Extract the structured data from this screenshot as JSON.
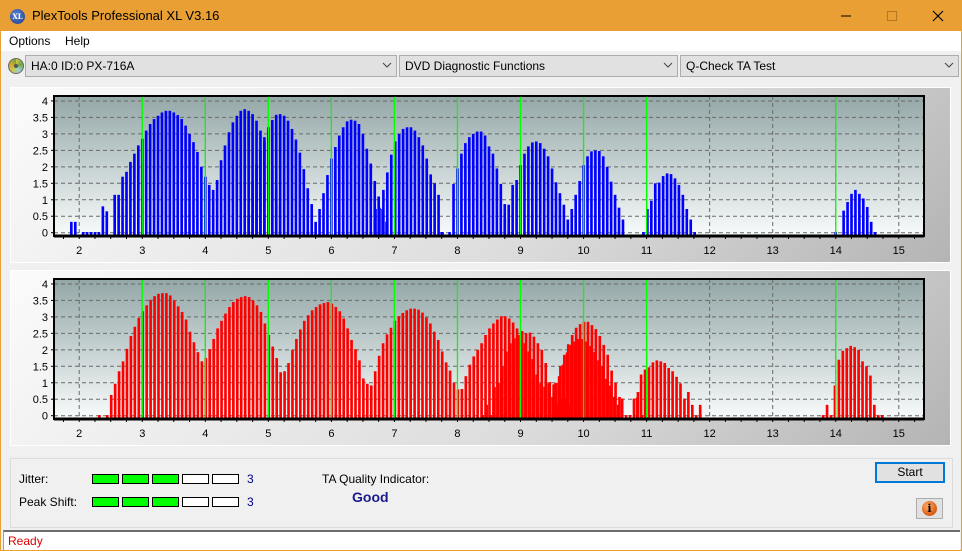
{
  "window": {
    "title": "PlexTools Professional XL V3.16",
    "icon_label": "XL",
    "controls": [
      "minimize-icon",
      "maximize-icon",
      "close-icon"
    ]
  },
  "menu": {
    "items": [
      "Options",
      "Help"
    ]
  },
  "toolbar": {
    "drive": "HA:0 ID:0  PX-716A",
    "function_group": "DVD Diagnostic Functions",
    "test": "Q-Check TA Test"
  },
  "colors": {
    "titlebar": "#e99f34",
    "land_bars": "#0000ff",
    "pit_bars": "#ff0000",
    "reference_lines": "#00ff00",
    "meter_on": "#00ff00",
    "status_text": "#e00000",
    "quality_text": "#1a1a8c"
  },
  "chart_data": [
    {
      "type": "bar",
      "name": "top-chart",
      "series_color": "#0000ff",
      "x_ticks": [
        "2",
        "3",
        "4",
        "5",
        "6",
        "7",
        "8",
        "9",
        "10",
        "11",
        "12",
        "13",
        "14",
        "15"
      ],
      "y_ticks": [
        "0",
        "0.5",
        "1",
        "1.5",
        "2",
        "2.5",
        "3",
        "3.5",
        "4"
      ],
      "xlim": [
        1.6,
        15.4
      ],
      "ylim": [
        -0.1,
        4.15
      ],
      "reference_lines_x": [
        3,
        4,
        5,
        6,
        7,
        8,
        9,
        10,
        11,
        14
      ],
      "grid": true,
      "bar_step": 0.0625,
      "clusters": [
        {
          "start": 1.875,
          "values": [
            0.33,
            0.33,
            0,
            0.02,
            0.02,
            0.02,
            0.02,
            0.02,
            0.8,
            0.65,
            0,
            1.15,
            1.15,
            1.7,
            1.85,
            2.15,
            2.4,
            2.65,
            2.85,
            3.1,
            3.3,
            3.45,
            3.55,
            3.65,
            3.7,
            3.7,
            3.65,
            3.57,
            3.45,
            3.25,
            3.0,
            2.75,
            2.45,
            2.0,
            1.7,
            1.45,
            1.3,
            1.6,
            2.2,
            2.65,
            3.05,
            3.35,
            3.55,
            3.7,
            3.75,
            3.7,
            3.6,
            3.4,
            3.1,
            2.75,
            2.2,
            1.9,
            1.35,
            0.85
          ]
        },
        {
          "start": 4.5,
          "values": [
            0.02,
            0,
            0.02,
            0.52,
            1.58,
            2.07,
            2.5,
            2.9,
            3.2,
            3.42,
            3.58,
            3.6,
            3.55,
            3.4,
            3.15,
            2.83,
            2.43,
            1.93,
            1.35,
            0.87
          ]
        },
        {
          "start": 5.75,
          "values": [
            0.33,
            0.72,
            1.2,
            1.75,
            2.25,
            2.6,
            2.95,
            3.2,
            3.38,
            3.43,
            3.4,
            3.3,
            3.0,
            2.55,
            2.1,
            1.57,
            1.1,
            0.72,
            0.33
          ]
        },
        {
          "start": 6.7,
          "values": [
            0.72,
            0.76,
            1.3,
            1.83,
            2.37,
            2.77,
            3.0,
            3.15,
            3.2,
            3.2,
            3.1,
            2.9,
            2.65,
            2.25,
            1.77,
            1.5,
            1.15,
            0.02
          ]
        },
        {
          "start": 7.75,
          "values": [
            0.02,
            0,
            0.02,
            1.48,
            1.95,
            2.4,
            2.72,
            2.9,
            3.0,
            3.07,
            3.07,
            2.95,
            2.62,
            2.4,
            1.95,
            1.48,
            0.87,
            0.02,
            0.02
          ]
        },
        {
          "start": 8.75,
          "values": [
            0.4,
            0.85,
            1.45,
            1.6,
            2.05,
            2.4,
            2.62,
            2.74,
            2.77,
            2.72,
            2.55,
            2.32,
            1.95,
            1.53,
            1.2,
            0.85
          ]
        },
        {
          "start": 9.75,
          "values": [
            0.4,
            0.72,
            1.15,
            1.57,
            2.05,
            2.32,
            2.47,
            2.5,
            2.48,
            2.32,
            2.0,
            1.55,
            1.15,
            0.76,
            0.4
          ]
        },
        {
          "start": 10.95,
          "values": [
            0.02,
            0.72,
            0.97,
            1.5,
            1.52,
            1.72,
            1.8,
            1.78,
            1.65,
            1.45,
            1.15,
            0.72,
            0.4,
            0.02
          ]
        },
        {
          "start": 14.0,
          "values": [
            0.02,
            0,
            0.67,
            0.93,
            1.18,
            1.3,
            1.18,
            1.04,
            0.78,
            0.33,
            0.02
          ]
        }
      ]
    },
    {
      "type": "bar",
      "name": "bottom-chart",
      "series_color": "#ff0000",
      "x_ticks": [
        "2",
        "3",
        "4",
        "5",
        "6",
        "7",
        "8",
        "9",
        "10",
        "11",
        "12",
        "13",
        "14",
        "15"
      ],
      "y_ticks": [
        "0",
        "0.5",
        "1",
        "1.5",
        "2",
        "2.5",
        "3",
        "3.5",
        "4"
      ],
      "xlim": [
        1.6,
        15.4
      ],
      "ylim": [
        -0.1,
        4.15
      ],
      "reference_lines_x": [
        3,
        4,
        5,
        6,
        7,
        8,
        9,
        10,
        11,
        14
      ],
      "grid": true,
      "bar_step": 0.0625,
      "clusters": [
        {
          "start": 2.32,
          "values": [
            0.02,
            0,
            0.02,
            0.63,
            0.97,
            1.35,
            1.65,
            2.03,
            2.42,
            2.7,
            2.97,
            3.17,
            3.35,
            3.52,
            3.63,
            3.7,
            3.72,
            3.72,
            3.65,
            3.5,
            3.32,
            3.15,
            2.92,
            2.55,
            2.23,
            1.93,
            1.65,
            1.75,
            2.02,
            2.33,
            2.65,
            2.88,
            3.1,
            3.3,
            3.45,
            3.55,
            3.6,
            3.63,
            3.6,
            3.5,
            3.35,
            3.15,
            2.8,
            2.45,
            2.1,
            1.75,
            1.32,
            1.35,
            1.6,
            2.0,
            2.33,
            2.62,
            2.88,
            3.05,
            3.2,
            3.3,
            3.38,
            3.42,
            3.45,
            3.4,
            3.3,
            3.17,
            2.95,
            2.65,
            2.3,
            2.02,
            1.68,
            1.13,
            0.97,
            0.92,
            1.35,
            1.82,
            2.2,
            2.47,
            2.67,
            2.88,
            3.02,
            3.12,
            3.2,
            3.25,
            3.25,
            3.22,
            3.13,
            2.98,
            2.8,
            2.55,
            2.3,
            1.95,
            1.62,
            1.37,
            1.0,
            0.8,
            0.81,
            1.2,
            1.55,
            1.8,
            2.0,
            2.2,
            2.45,
            2.65,
            2.8,
            2.92,
            3.02,
            3.02,
            2.95,
            2.83,
            2.65,
            2.45,
            2.2,
            1.95,
            1.72,
            1.25,
            0.98,
            0.88,
            0.98,
            0.57,
            1.0,
            1.5,
            1.85,
            2.17,
            2.45,
            2.67,
            2.78,
            2.85,
            2.85,
            2.75,
            2.63,
            2.42,
            2.15,
            1.85,
            1.37,
            1.0,
            0.57
          ]
        },
        {
          "start": 8.4,
          "values": [
            0.02,
            0.33,
            0.02,
            0.87,
            1.0,
            1.5,
            1.95,
            2.2,
            2.35,
            2.45,
            2.57,
            2.5,
            2.52,
            2.4,
            2.2,
            2.0,
            1.6,
            1.02,
            0.95,
            0.33,
            0.52,
            0.52,
            0.33
          ]
        },
        {
          "start": 9.55,
          "values": [
            0.98,
            1.2,
            1.55,
            1.92,
            2.15,
            2.25,
            2.33,
            2.33,
            2.25,
            2.12,
            1.93,
            1.68,
            1.5,
            1.12,
            0.92,
            0.57,
            0.33,
            0.52,
            0.02,
            0.02,
            0.52,
            0.72,
            0.02
          ]
        },
        {
          "start": 10.85,
          "values": [
            0.55,
            1.25,
            1.4,
            1.47,
            1.62,
            1.68,
            1.65,
            1.6,
            1.45,
            1.35,
            1.18,
            0.98,
            0.52,
            0.72,
            0.33,
            0.02,
            0.33
          ]
        },
        {
          "start": 13.8,
          "values": [
            0.02,
            0.33,
            0.02,
            0.92,
            1.7,
            1.97,
            2.05,
            2.12,
            2.08,
            2.0,
            1.65,
            1.5,
            1.22,
            0.33,
            0.02,
            0.02
          ]
        }
      ]
    }
  ],
  "metrics": {
    "jitter": {
      "label": "Jitter:",
      "value": "3",
      "level": 3,
      "max": 5
    },
    "peak_shift": {
      "label": "Peak Shift:",
      "value": "3",
      "level": 3,
      "max": 5
    },
    "ta_quality_label": "TA Quality Indicator:",
    "ta_quality_value": "Good"
  },
  "buttons": {
    "start": "Start",
    "info_icon": "info-icon"
  },
  "status": {
    "text": "Ready"
  }
}
